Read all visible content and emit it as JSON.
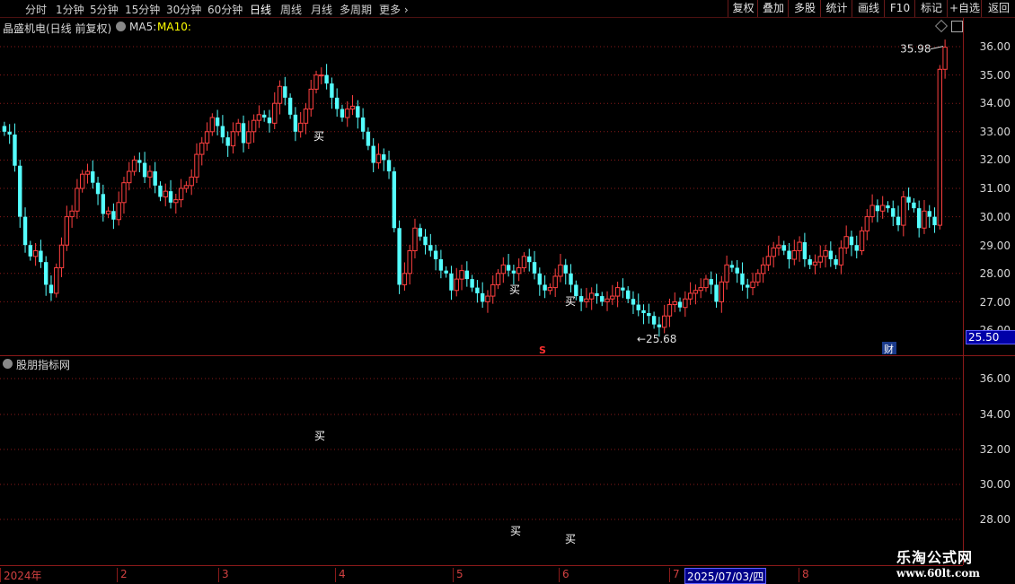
{
  "toolbar": {
    "left": [
      "分时",
      "1分钟",
      "5分钟",
      "15分钟",
      "30分钟",
      "60分钟",
      "日线",
      "周线",
      "月线",
      "多周期",
      "更多"
    ],
    "active": "日线",
    "right": [
      "复权",
      "叠加",
      "多股",
      "统计",
      "画线",
      "F10",
      "标记",
      "+自选",
      "返回"
    ]
  },
  "info": {
    "stock": "晶盛机电(日线 前复权)",
    "ma5": "MA5:",
    "ma10": "MA10:"
  },
  "sub_panel_title": "股朋指标网",
  "main_axis": [
    "36.00",
    "35.00",
    "34.00",
    "33.00",
    "32.00",
    "31.00",
    "30.00",
    "29.00",
    "28.00",
    "27.00",
    "26.00"
  ],
  "sub_axis": [
    "36.00",
    "34.00",
    "32.00",
    "30.00",
    "28.00"
  ],
  "current_price": "25.50",
  "high_label": "35.98",
  "low_label": "25.68",
  "buy_label": "买",
  "markers": {
    "s": "S",
    "cai": "财"
  },
  "dates": [
    "2024年",
    "2",
    "3",
    "4",
    "5",
    "6",
    "7",
    "2025/07/03/四",
    "8"
  ],
  "watermark": {
    "line1": "乐淘公式网",
    "line2": "www.60lt.com"
  },
  "colors": {
    "up": "#ff4040",
    "down": "#54ffff",
    "grid": "#8a1a1a",
    "ma10": "#ffff00"
  },
  "chart_data": {
    "type": "candlestick",
    "ylim": [
      26,
      36.4
    ],
    "close": [
      33.0,
      32.9,
      31.8,
      30.0,
      29.0,
      28.6,
      28.8,
      28.4,
      27.6,
      27.3,
      28.2,
      29.0,
      30.0,
      30.2,
      31.0,
      31.5,
      31.6,
      31.2,
      30.8,
      30.1,
      30.2,
      29.9,
      30.5,
      31.2,
      31.6,
      32.0,
      31.9,
      31.4,
      31.6,
      31.1,
      30.7,
      30.9,
      30.5,
      30.6,
      31.0,
      31.1,
      31.4,
      32.2,
      32.6,
      33.0,
      33.5,
      33.2,
      32.8,
      32.5,
      33.0,
      33.3,
      32.6,
      33.0,
      33.4,
      33.6,
      33.5,
      33.3,
      34.0,
      34.6,
      34.2,
      33.6,
      33.0,
      33.3,
      33.8,
      34.5,
      35.0,
      35.0,
      34.7,
      34.2,
      33.8,
      33.5,
      33.8,
      33.9,
      33.5,
      33.0,
      32.5,
      31.9,
      32.2,
      32.0,
      31.6,
      29.6,
      27.6,
      28.0,
      28.8,
      29.6,
      29.3,
      29.0,
      28.8,
      28.5,
      28.1,
      28.0,
      27.4,
      27.8,
      28.1,
      27.8,
      27.5,
      27.3,
      27.0,
      27.2,
      27.6,
      28.0,
      28.3,
      28.1,
      28.0,
      28.2,
      28.6,
      28.4,
      28.0,
      27.6,
      27.4,
      27.5,
      27.9,
      28.3,
      28.0,
      27.6,
      27.2,
      27.0,
      27.1,
      27.3,
      27.2,
      27.0,
      27.1,
      27.2,
      27.5,
      27.4,
      27.1,
      26.9,
      26.7,
      26.6,
      26.5,
      26.2,
      26.1,
      26.5,
      26.9,
      27.0,
      26.8,
      27.1,
      27.3,
      27.4,
      27.5,
      27.8,
      27.6,
      27.0,
      27.7,
      28.3,
      28.2,
      28.0,
      27.6,
      27.5,
      27.7,
      28.0,
      28.3,
      28.6,
      28.9,
      29.0,
      28.8,
      28.5,
      28.8,
      29.1,
      28.5,
      28.3,
      28.4,
      28.6,
      28.8,
      28.5,
      28.3,
      28.9,
      29.3,
      29.0,
      28.8,
      29.5,
      30.0,
      30.4,
      30.2,
      30.4,
      30.3,
      30.0,
      29.7,
      30.7,
      30.5,
      30.3,
      29.6,
      30.2,
      30.0,
      29.7,
      35.2,
      35.98
    ],
    "labels": {
      "high": 35.98,
      "low": 25.68
    }
  }
}
